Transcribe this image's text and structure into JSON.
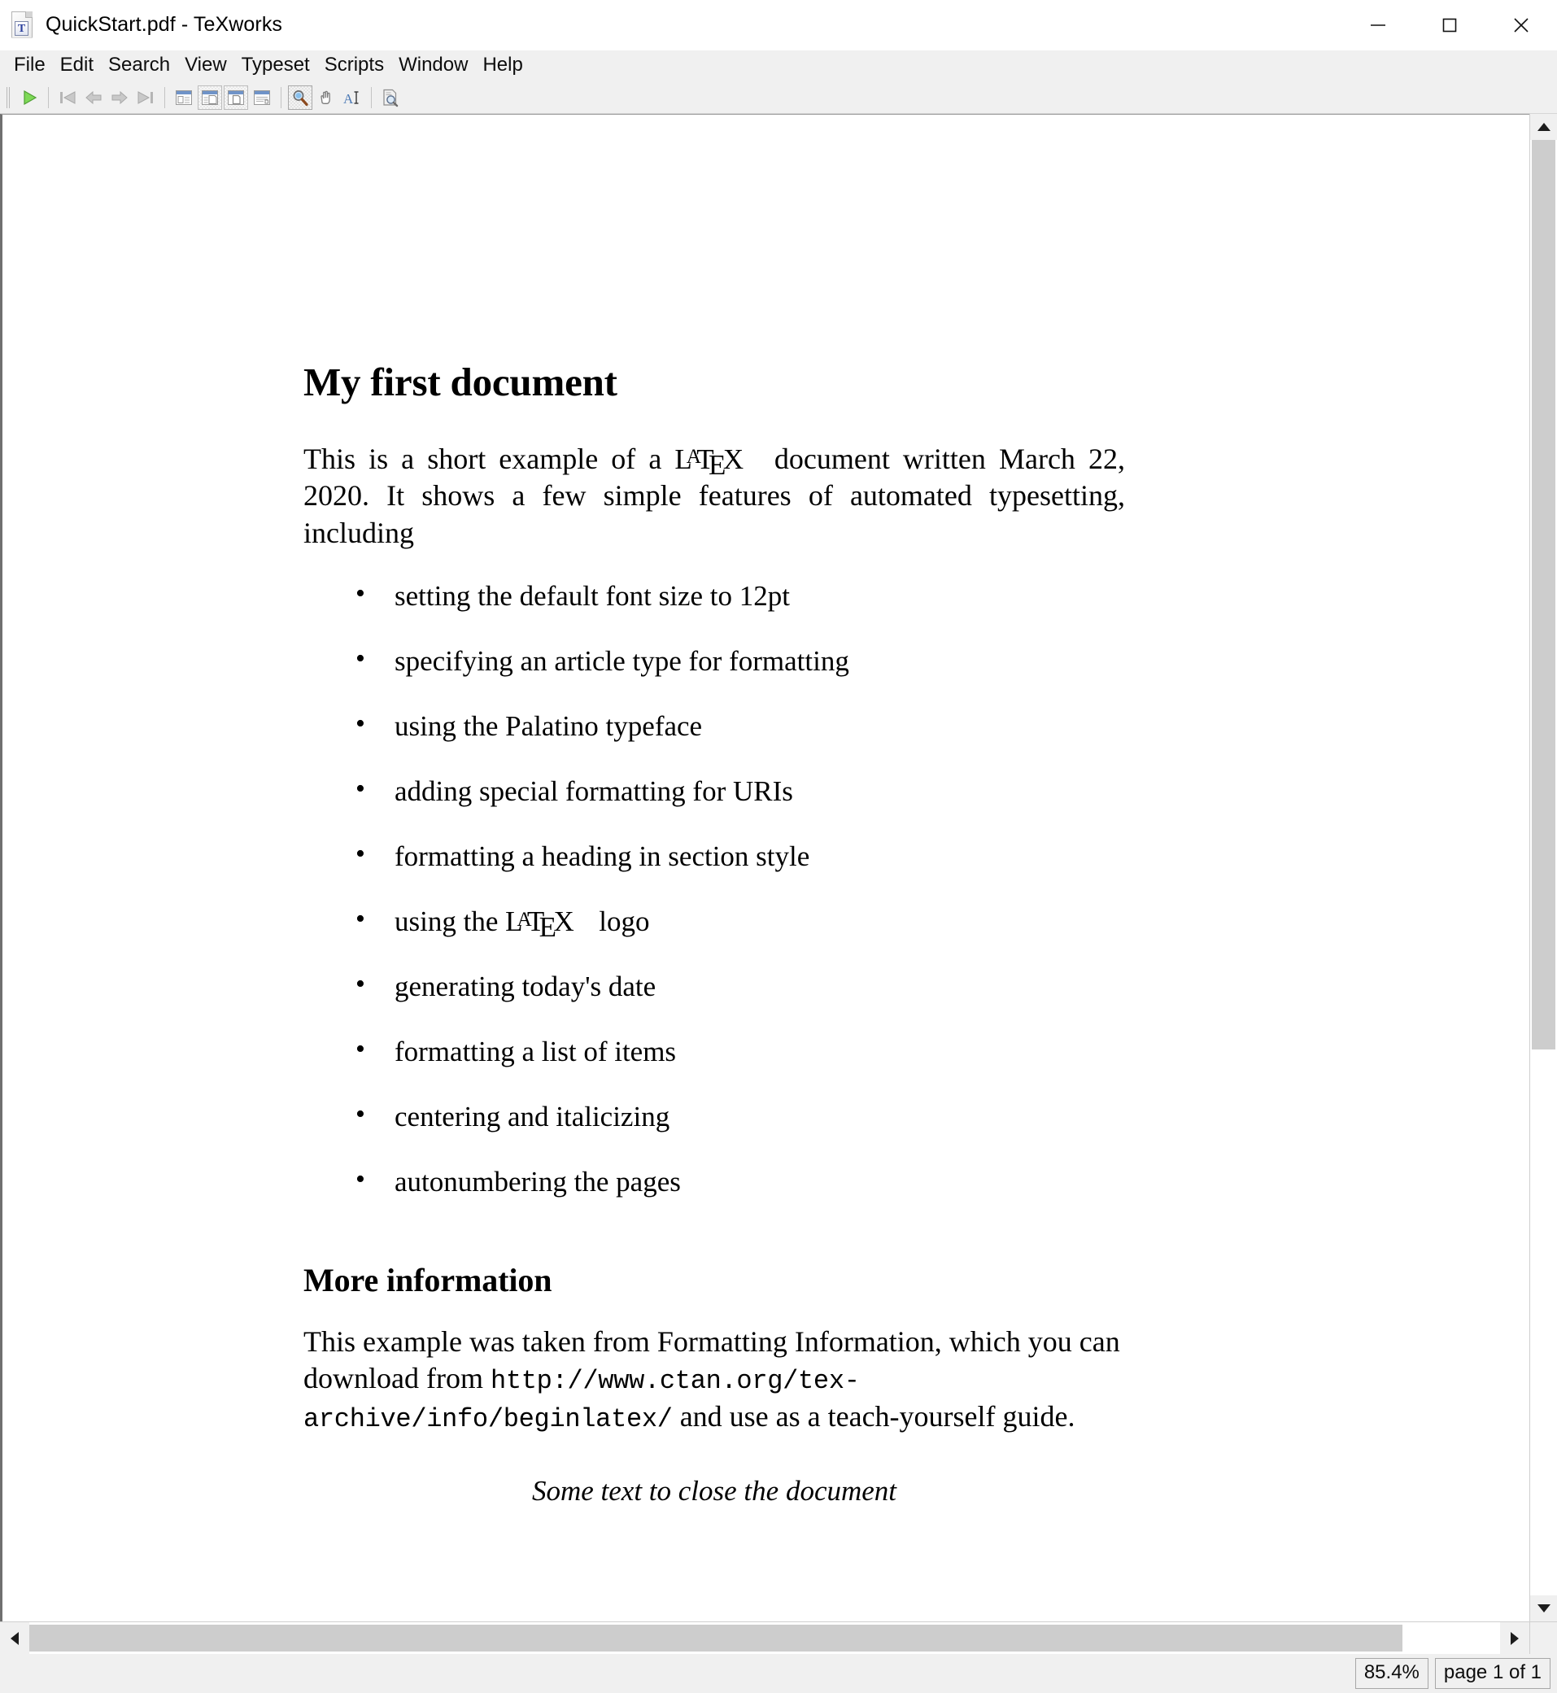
{
  "window": {
    "title": "QuickStart.pdf - TeXworks",
    "app_icon": "texworks-document-icon",
    "badge_letter": "T",
    "controls": {
      "minimize": "minimize-button",
      "maximize": "maximize-button",
      "close": "close-button"
    }
  },
  "menubar": {
    "items": [
      {
        "label": "File"
      },
      {
        "label": "Edit"
      },
      {
        "label": "Search"
      },
      {
        "label": "View"
      },
      {
        "label": "Typeset"
      },
      {
        "label": "Scripts"
      },
      {
        "label": "Window"
      },
      {
        "label": "Help"
      }
    ]
  },
  "toolbar": {
    "groups": [
      {
        "buttons": [
          {
            "name": "typeset-button",
            "icon": "play-triangle-icon",
            "state": "enabled"
          }
        ]
      },
      {
        "buttons": [
          {
            "name": "first-page-button",
            "icon": "first-page-icon",
            "state": "disabled"
          },
          {
            "name": "previous-page-button",
            "icon": "previous-page-icon",
            "state": "disabled"
          },
          {
            "name": "next-page-button",
            "icon": "next-page-icon",
            "state": "disabled"
          },
          {
            "name": "last-page-button",
            "icon": "last-page-icon",
            "state": "disabled"
          }
        ]
      },
      {
        "buttons": [
          {
            "name": "fit-width-button",
            "icon": "fit-width-icon",
            "state": "enabled"
          },
          {
            "name": "fit-window-button",
            "icon": "fit-window-icon",
            "state": "pressed-soft"
          },
          {
            "name": "actual-size-button",
            "icon": "actual-size-icon",
            "state": "pressed-soft"
          },
          {
            "name": "fit-content-button",
            "icon": "fit-content-icon",
            "state": "enabled"
          }
        ]
      },
      {
        "buttons": [
          {
            "name": "magnify-tool-button",
            "icon": "magnifier-icon",
            "state": "pressed"
          },
          {
            "name": "pan-tool-button",
            "icon": "hand-icon",
            "state": "enabled"
          },
          {
            "name": "select-text-tool-button",
            "icon": "text-select-icon",
            "state": "enabled"
          }
        ]
      },
      {
        "buttons": [
          {
            "name": "source-search-button",
            "icon": "document-magnifier-icon",
            "state": "enabled"
          }
        ]
      }
    ]
  },
  "document": {
    "heading": "My first document",
    "intro_before_logo": "This is a short example of a ",
    "intro_after_logo": " document written March 22, 2020.  It shows a few simple features of automated typesetting, including",
    "bullets": [
      "setting the default font size to 12pt",
      "specifying an article type for formatting",
      "using the Palatino typeface",
      "adding special formatting for URIs",
      "formatting a heading in section style",
      "using the LaTeX logo",
      "generating today's date",
      "formatting a list of items",
      "centering and italicizing",
      "autonumbering the pages"
    ],
    "bullet_logo_index": 5,
    "bullet_logo_before": "using the ",
    "bullet_logo_after": " logo",
    "section_heading": "More information",
    "more_text_before_url": "This example was taken from Formatting Information, which you can download from ",
    "url": "http://www.ctan.org/tex-archive/info/beginlatex/",
    "more_text_after_url": " and use as a teach-yourself guide.",
    "closing_italic": "Some text to close the document"
  },
  "statusbar": {
    "zoom": "85.4%",
    "page_indicator": "page 1 of 1"
  },
  "scrollbars": {
    "vertical_up": "scroll-up-arrow",
    "vertical_down": "scroll-down-arrow",
    "horizontal_left": "scroll-left-arrow",
    "horizontal_right": "scroll-right-arrow"
  },
  "colors": {
    "chrome": "#f0f0f0",
    "page": "#ffffff",
    "accent_play": "#56c233",
    "accent_titlebar_blue": "#5a7fc0",
    "scroll_thumb": "#cdcdcd",
    "close_hover": "#e81123"
  }
}
